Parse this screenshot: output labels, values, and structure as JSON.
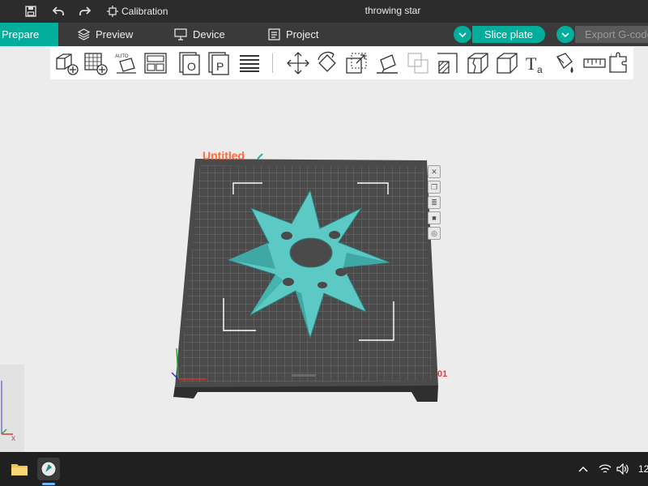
{
  "titlebar": {
    "calibration_label": "Calibration",
    "document_title": "throwing star",
    "icons": [
      "save-icon",
      "undo-icon",
      "redo-icon",
      "calibration-icon"
    ]
  },
  "navbar": {
    "tabs": [
      {
        "label": "Prepare",
        "active": true
      },
      {
        "label": "Preview",
        "icon": "cube-stack-icon"
      },
      {
        "label": "Device",
        "icon": "device-icon"
      },
      {
        "label": "Project",
        "icon": "project-icon"
      }
    ],
    "slice_label": "Slice plate",
    "export_label": "Export G-code"
  },
  "toolbar": {
    "tools": [
      "add-object-icon",
      "add-plate-icon",
      "auto-orient-icon",
      "arrange-icon",
      "split-objects-icon",
      "split-parts-icon",
      "variable-layer-icon",
      "move-icon",
      "rotate-icon",
      "scale-icon",
      "lay-on-face-icon",
      "boolean-icon",
      "cut-icon",
      "seam-icon",
      "support-paint-icon",
      "text-icon",
      "color-paint-icon",
      "measure-icon",
      "assembly-icon"
    ]
  },
  "viewport": {
    "plate_name": "Untitled",
    "plate_number": "01",
    "axis_x_label": "x",
    "colors": {
      "plate": "#4a4a4a",
      "grid": "#7a7a7a",
      "model": "#5cc9c5",
      "brand": "#00ae9b"
    }
  },
  "taskbar": {
    "clock": "12",
    "icons": [
      "file-explorer-icon",
      "slicer-app-icon",
      "chevron-up-icon",
      "wifi-icon",
      "volume-icon"
    ]
  }
}
